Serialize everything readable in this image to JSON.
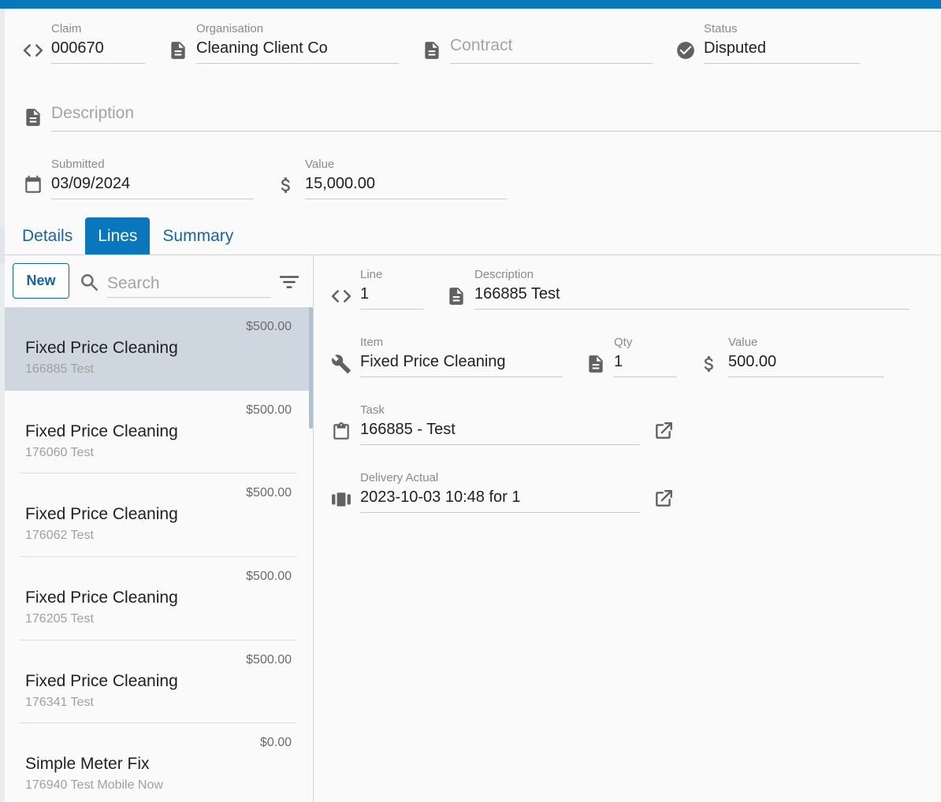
{
  "header": {
    "claim": {
      "label": "Claim",
      "value": "000670"
    },
    "organisation": {
      "label": "Organisation",
      "value": "Cleaning Client Co"
    },
    "contract": {
      "placeholder": "Contract"
    },
    "status": {
      "label": "Status",
      "value": "Disputed"
    },
    "description": {
      "placeholder": "Description"
    },
    "submitted": {
      "label": "Submitted",
      "value": "03/09/2024"
    },
    "value": {
      "label": "Value",
      "value": "15,000.00"
    }
  },
  "tabs": [
    {
      "label": "Details",
      "active": false
    },
    {
      "label": "Lines",
      "active": true
    },
    {
      "label": "Summary",
      "active": false
    }
  ],
  "list": {
    "new_label": "New",
    "search_placeholder": "Search",
    "items": [
      {
        "price": "$500.00",
        "name": "Fixed Price Cleaning",
        "sub": "166885 Test",
        "selected": true
      },
      {
        "price": "$500.00",
        "name": "Fixed Price Cleaning",
        "sub": "176060 Test"
      },
      {
        "price": "$500.00",
        "name": "Fixed Price Cleaning",
        "sub": "176062 Test"
      },
      {
        "price": "$500.00",
        "name": "Fixed Price Cleaning",
        "sub": "176205 Test"
      },
      {
        "price": "$500.00",
        "name": "Fixed Price Cleaning",
        "sub": "176341 Test"
      },
      {
        "price": "$0.00",
        "name": "Simple Meter Fix",
        "sub": "176940 Test Mobile Now"
      }
    ]
  },
  "detail": {
    "line": {
      "label": "Line",
      "value": "1"
    },
    "description": {
      "label": "Description",
      "value": "166885 Test"
    },
    "item": {
      "label": "Item",
      "value": "Fixed Price Cleaning"
    },
    "qty": {
      "label": "Qty",
      "value": "1"
    },
    "value": {
      "label": "Value",
      "value": "500.00"
    },
    "task": {
      "label": "Task",
      "value": "166885 - Test"
    },
    "delivery": {
      "label": "Delivery Actual",
      "value": "2023-10-03 10:48 for 1"
    }
  },
  "colors": {
    "accent": "#0a77bd",
    "selected_row": "#ced7e0",
    "link_text": "#1565a6"
  },
  "icons": [
    "code-icon",
    "document-icon",
    "check-circle-icon",
    "calendar-icon",
    "dollar-icon",
    "search-icon",
    "filter-icon",
    "wrench-icon",
    "clipboard-icon",
    "delivery-icon",
    "open-in-new-icon"
  ]
}
